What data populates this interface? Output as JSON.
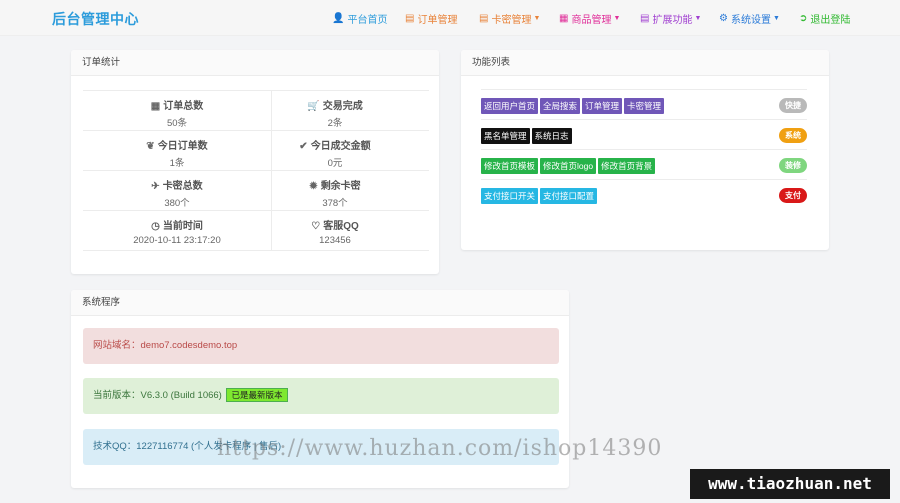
{
  "brand": "后台管理中心",
  "nav": [
    {
      "label": "平台首页",
      "icon": "user-icon",
      "color": "#2d9cdb",
      "caret": false
    },
    {
      "label": "订单管理",
      "icon": "list-icon",
      "color": "#e8833a",
      "caret": false
    },
    {
      "label": "卡密管理",
      "icon": "card-icon",
      "color": "#e8833a",
      "caret": true
    },
    {
      "label": "商品管理",
      "icon": "grid-icon",
      "color": "#e0309a",
      "caret": true
    },
    {
      "label": "扩展功能",
      "icon": "doc-icon",
      "color": "#a03fd0",
      "caret": true
    },
    {
      "label": "系统设置",
      "icon": "gear-icon",
      "color": "#2b7bd8",
      "caret": true
    },
    {
      "label": "退出登陆",
      "icon": "exit-icon",
      "color": "#2eb82e",
      "caret": false
    }
  ],
  "stats_panel": {
    "title": "订单统计",
    "items": [
      {
        "title": "订单总数",
        "value": "50条",
        "icon": "grid-icon"
      },
      {
        "title": "交易完成",
        "value": "2条",
        "icon": "cart-icon"
      },
      {
        "title": "今日订单数",
        "value": "1条",
        "icon": "leaf-icon"
      },
      {
        "title": "今日成交金额",
        "value": "0元",
        "icon": "check-icon"
      },
      {
        "title": "卡密总数",
        "value": "380个",
        "icon": "plane-icon"
      },
      {
        "title": "剩余卡密",
        "value": "378个",
        "icon": "sun-icon"
      },
      {
        "title": "当前时间",
        "value": "2020-10-11 23:17:20",
        "icon": "clock-icon"
      },
      {
        "title": "客服QQ",
        "value": "123456",
        "icon": "heart-icon"
      }
    ]
  },
  "func_panel": {
    "title": "功能列表",
    "rows": [
      {
        "tags": [
          "返回用户首页",
          "全局搜索",
          "订单管理",
          "卡密管理"
        ],
        "tag_color": "#7057b8",
        "badge": "快捷",
        "badge_color": "#b9b9b9"
      },
      {
        "tags": [
          "黑名单管理",
          "系统日志"
        ],
        "tag_color": "#111111",
        "badge": "系统",
        "badge_color": "#f0a012"
      },
      {
        "tags": [
          "修改首页模板",
          "修改首页logo",
          "修改首页背景"
        ],
        "tag_color": "#27b34a",
        "badge": "装修",
        "badge_color": "#7fd67f"
      },
      {
        "tags": [
          "支付接口开关",
          "支付接口配置"
        ],
        "tag_color": "#26b7e3",
        "badge": "支付",
        "badge_color": "#d91818"
      }
    ]
  },
  "system_panel": {
    "title": "系统程序",
    "domain_text": "网站域名：demo7.codesdemo.top",
    "version_text": "当前版本：V6.3.0 (Build 1066)",
    "version_badge": "已是最新版本",
    "qq_text": "技术QQ：1227116774 (个人发卡程序 | 售后)"
  },
  "watermark": {
    "url": "https://www.huzhan.com/ishop14390",
    "site": "www.tiaozhuan.net"
  }
}
